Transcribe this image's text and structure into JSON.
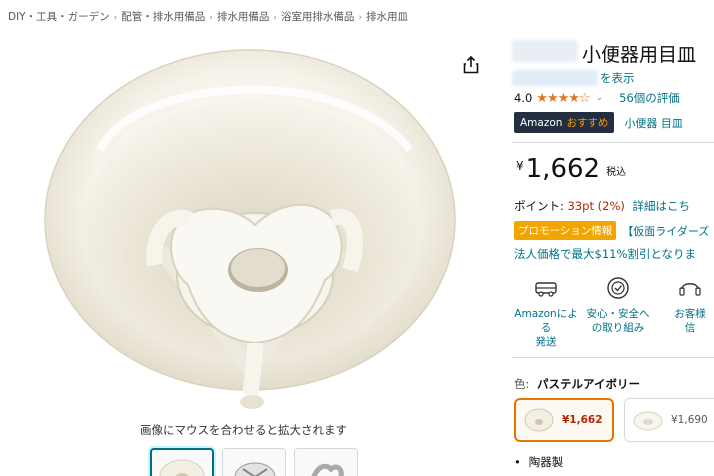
{
  "breadcrumb": [
    {
      "label": "DIY・工具・ガーデン"
    },
    {
      "label": "配管・排水用備品"
    },
    {
      "label": "排水用備品"
    },
    {
      "label": "浴室用排水備品"
    },
    {
      "label": "排水用皿"
    }
  ],
  "breadcrumb_separator": "›",
  "product": {
    "title": "小便器用目皿",
    "store_link": "を表示",
    "rating_value": "4.0",
    "stars": "★★★★",
    "star_empty": "☆",
    "rating_chevron": "⌄",
    "review_count": "56個の評価",
    "badge_main": "Amazon",
    "badge_accent": "おすすめ",
    "badge_keyword": "小便器 目皿",
    "price_symbol": "¥",
    "price_amount": "1,662",
    "tax_label": "税込",
    "points_label": "ポイント:",
    "points_pt": "33pt",
    "points_pct": "(2%)",
    "points_detail": "詳細はこち",
    "promo_badge": "プロモーション情報",
    "promo_link": "【仮面ライダーズ",
    "biz_price": "法人価格で最大$11%割引となりま"
  },
  "features": [
    {
      "icon": "delivery-truck-icon",
      "label_line1": "Amazonによる",
      "label_line2": "発送"
    },
    {
      "icon": "shield-check-icon",
      "label_line1": "安心・安全へ",
      "label_line2": "の取り組み"
    },
    {
      "icon": "customer-service-icon",
      "label_line1": "お客様",
      "label_line2": "信"
    }
  ],
  "color": {
    "label": "色:",
    "value": "パステルアイボリー"
  },
  "variants": [
    {
      "price": "¥1,662",
      "selected": true
    },
    {
      "price": "¥1,690",
      "selected": false
    }
  ],
  "bullet": {
    "dot": "•",
    "text": "陶器製"
  },
  "image": {
    "zoom_hint": "画像にマウスを合わせると拡大されます",
    "main_color": "#f3efe2"
  },
  "colors": {
    "link": "#007185",
    "price_red": "#b12704",
    "star": "#de7921",
    "badge_dark": "#232f3e",
    "badge_accent": "#ff9900",
    "promo": "#f0a500",
    "selected_border": "#e77600"
  }
}
